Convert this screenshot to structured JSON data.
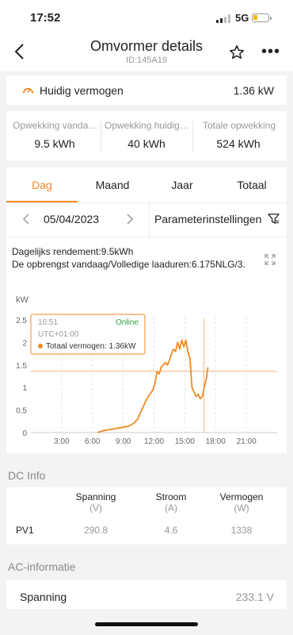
{
  "status_bar": {
    "time": "17:52",
    "network": "5G"
  },
  "nav": {
    "title": "Omvormer details",
    "subtitle": "ID:145A19"
  },
  "current_power": {
    "label": "Huidig vermogen",
    "value": "1.36 kW"
  },
  "stats": [
    {
      "label": "Opwekking vandaag",
      "value": "9.5 kWh"
    },
    {
      "label": "Opwekking huidige maand",
      "value": "40 kWh"
    },
    {
      "label": "Totale opwekking",
      "value": "524 kWh"
    }
  ],
  "tabs": [
    "Dag",
    "Maand",
    "Jaar",
    "Totaal"
  ],
  "date_bar": {
    "date": "05/04/2023",
    "params_label": "Parameterinstellingen"
  },
  "chart_info": {
    "daily_yield": "Dagelijks rendement:9.5kWh",
    "today_yield": "De opbrengst vandaag/Volledige laaduren:6.175NLG/3."
  },
  "chart_data": {
    "type": "line",
    "ylabel": "kW",
    "ylim": [
      0,
      2.5
    ],
    "yticks": [
      "0",
      "0.5",
      "1",
      "1.5",
      "2",
      "2.5"
    ],
    "xticks": [
      "3:00",
      "6:00",
      "9:00",
      "12:00",
      "15:00",
      "18:00",
      "21:00"
    ],
    "xlim_hours": [
      0,
      24
    ],
    "grid": "vertical dashed",
    "color": "#f08a24",
    "series": [
      {
        "points": [
          [
            6.5,
            0.0
          ],
          [
            7.0,
            0.04
          ],
          [
            7.5,
            0.06
          ],
          [
            8.0,
            0.08
          ],
          [
            8.5,
            0.1
          ],
          [
            9.0,
            0.12
          ],
          [
            9.5,
            0.14
          ],
          [
            10.0,
            0.2
          ],
          [
            10.4,
            0.3
          ],
          [
            10.7,
            0.45
          ],
          [
            11.0,
            0.6
          ],
          [
            11.3,
            0.75
          ],
          [
            11.6,
            0.85
          ],
          [
            11.9,
            0.95
          ],
          [
            12.1,
            1.1
          ],
          [
            12.3,
            1.35
          ],
          [
            12.5,
            1.3
          ],
          [
            12.7,
            1.45
          ],
          [
            12.9,
            1.5
          ],
          [
            13.1,
            1.55
          ],
          [
            13.3,
            1.5
          ],
          [
            13.5,
            1.6
          ],
          [
            13.7,
            1.75
          ],
          [
            13.9,
            1.85
          ],
          [
            14.1,
            1.8
          ],
          [
            14.3,
            2.0
          ],
          [
            14.5,
            1.85
          ],
          [
            14.7,
            2.05
          ],
          [
            14.9,
            1.9
          ],
          [
            15.1,
            2.05
          ],
          [
            15.3,
            1.8
          ],
          [
            15.5,
            1.65
          ],
          [
            15.7,
            1.0
          ],
          [
            15.9,
            0.9
          ],
          [
            16.1,
            0.8
          ],
          [
            16.3,
            0.85
          ],
          [
            16.5,
            0.75
          ],
          [
            16.7,
            0.8
          ],
          [
            16.9,
            1.0
          ],
          [
            17.1,
            1.2
          ],
          [
            17.25,
            1.45
          ]
        ]
      }
    ],
    "tooltip": {
      "time": "16:51",
      "tz": "UTC+01:00",
      "status": "Online",
      "series_label": "Totaal vermogen: 1.36kW",
      "cursor_x": 16.85,
      "cursor_y": 1.36
    }
  },
  "dc_info": {
    "title": "DC Info",
    "columns": [
      {
        "name": "Spanning",
        "unit": "(V)"
      },
      {
        "name": "Stroom",
        "unit": "(A)"
      },
      {
        "name": "Vermogen",
        "unit": "(W)"
      }
    ],
    "rows": [
      {
        "label": "PV1",
        "values": [
          "290.8",
          "4.6",
          "1338"
        ]
      }
    ]
  },
  "ac_info": {
    "title": "AC-informatie",
    "rows": [
      {
        "label": "Spanning",
        "value": "233.1 V"
      }
    ]
  },
  "colors": {
    "accent": "#f08a24",
    "online": "#2e9d3c"
  }
}
